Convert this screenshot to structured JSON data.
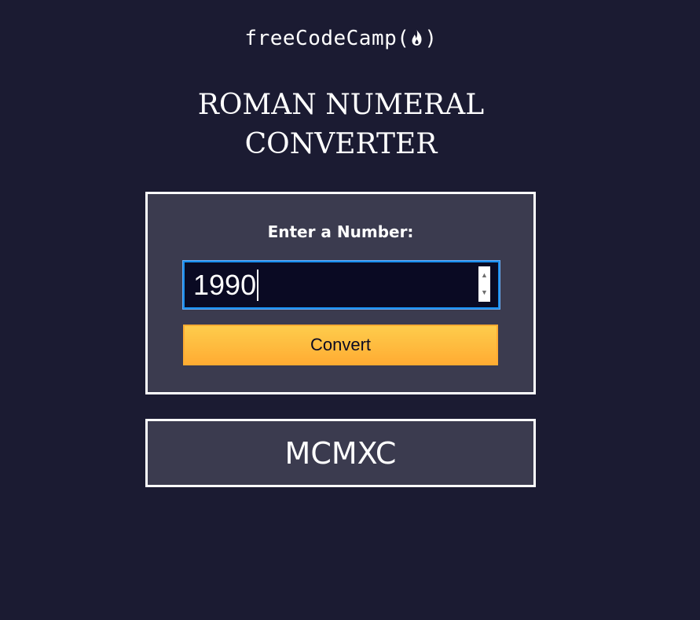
{
  "header": {
    "logo_text": "freeCodeCamp(",
    "logo_text_end": ")",
    "logo_icon": "flame-icon"
  },
  "title": {
    "line1": "ROMAN NUMERAL",
    "line2": "CONVERTER"
  },
  "form": {
    "label": "Enter a Number:",
    "input_value": "1990",
    "button_label": "Convert"
  },
  "output": {
    "result": "MCMXC"
  },
  "colors": {
    "background": "#1b1b32",
    "panel": "#3b3b4f",
    "input_bg": "#0a0a23",
    "button": "#feac32"
  }
}
